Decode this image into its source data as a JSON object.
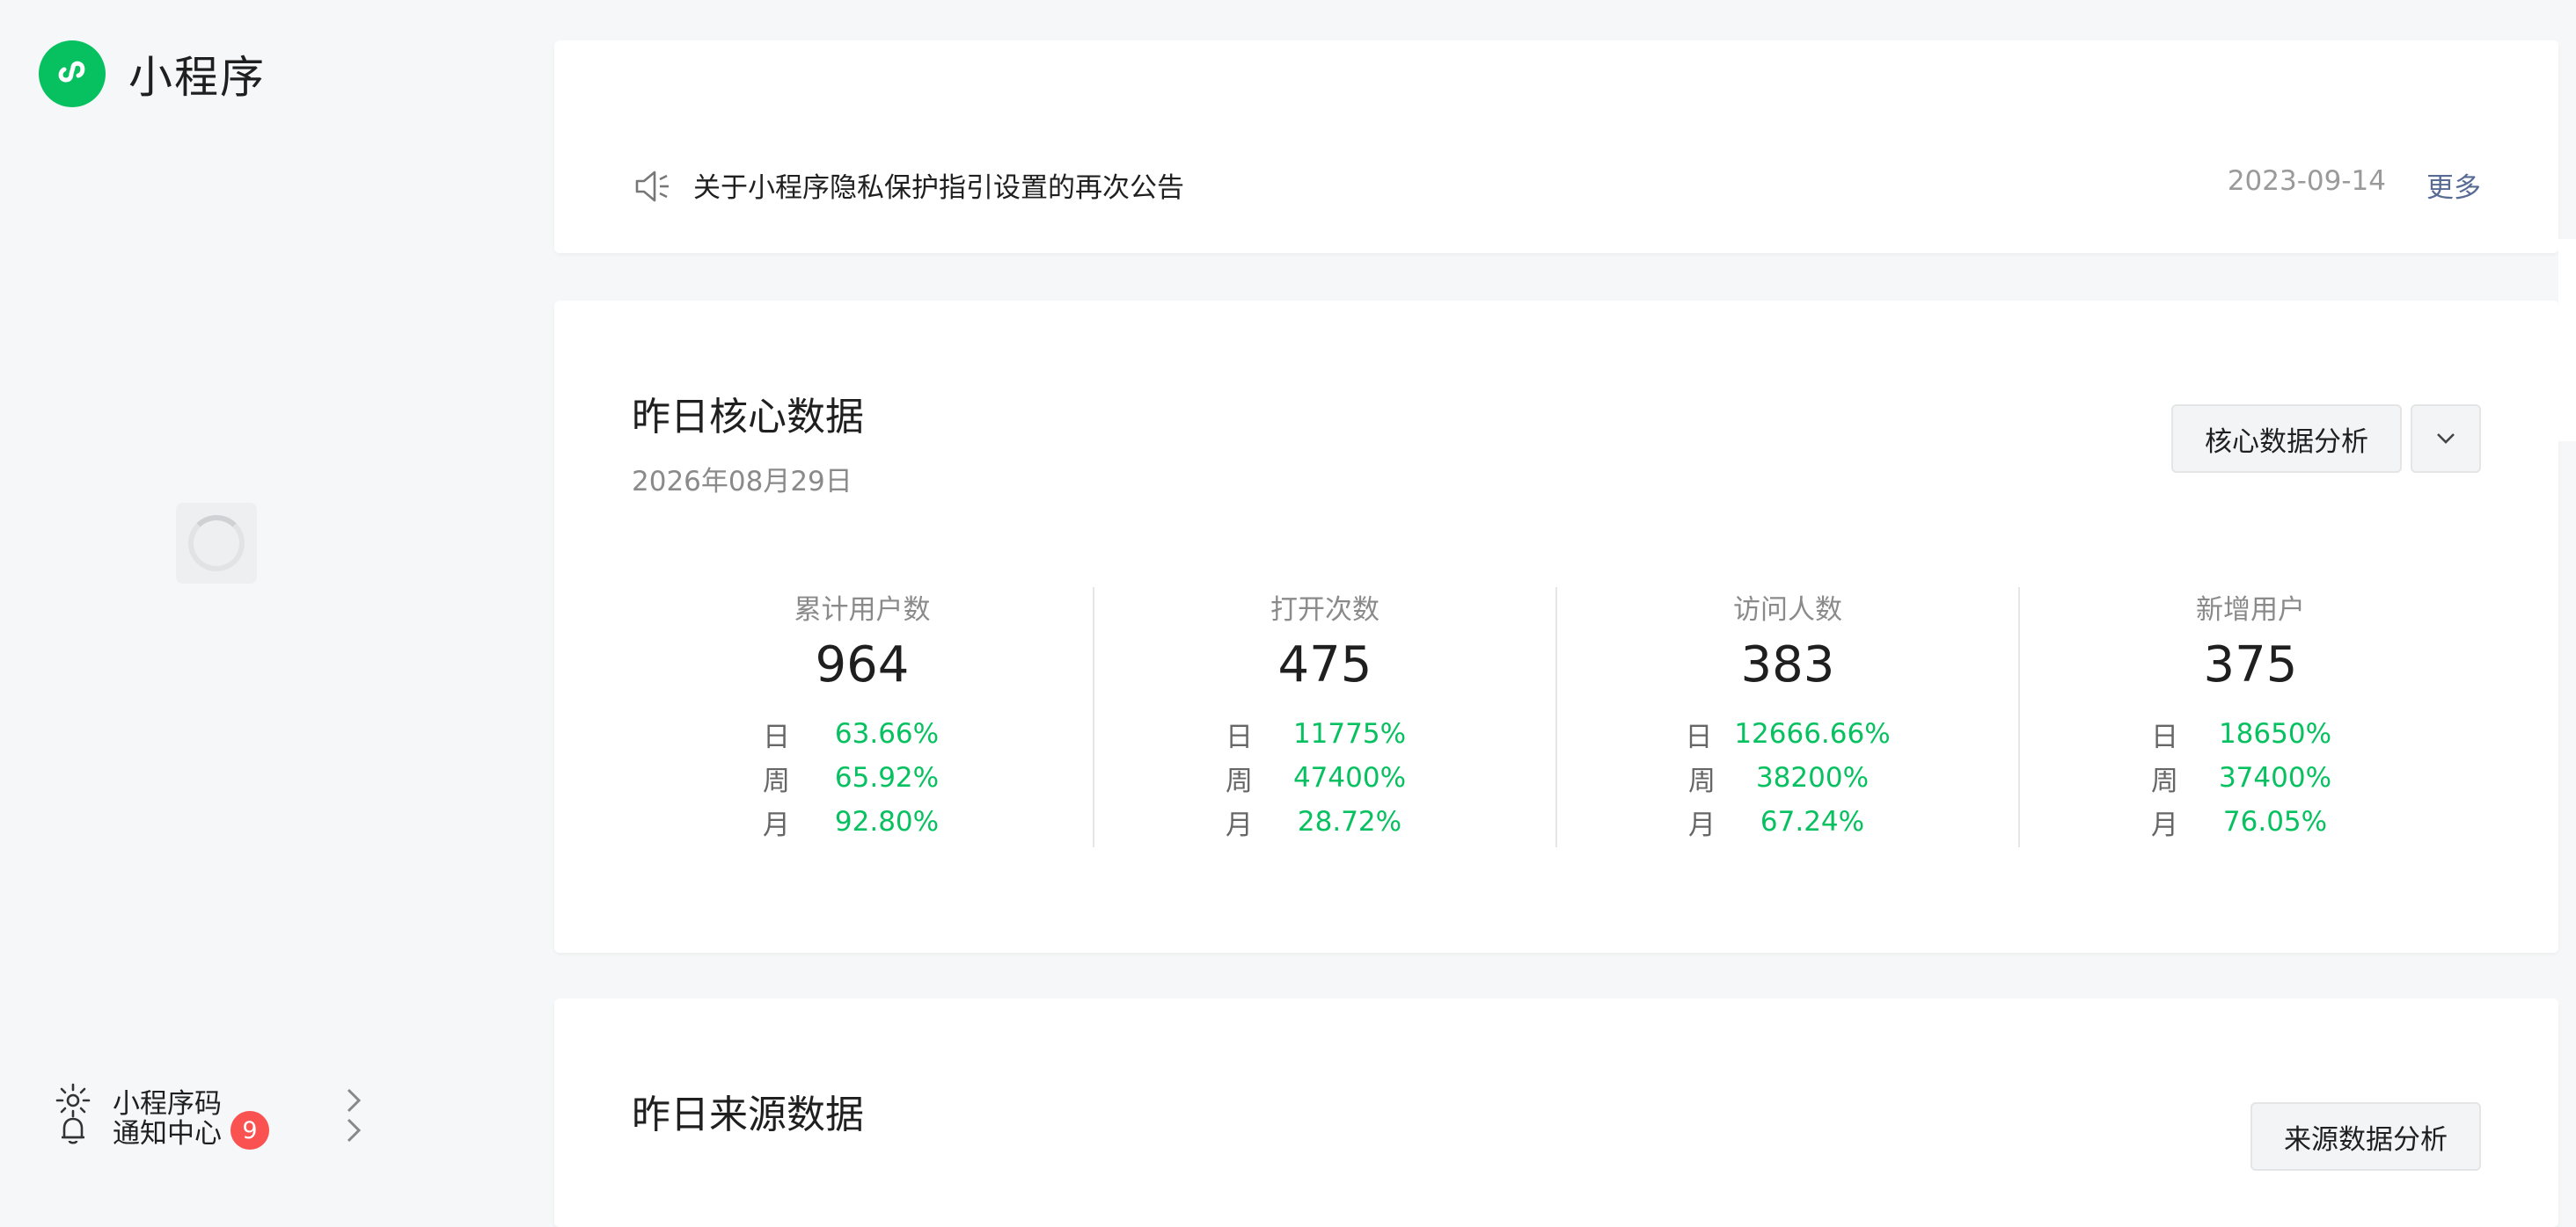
{
  "app": {
    "title": "小程序"
  },
  "sidebar": {
    "items": [
      {
        "label": "小程序码",
        "icon": "qrcode-sparkle-icon"
      },
      {
        "label": "通知中心",
        "icon": "bell-icon",
        "badge": "9"
      }
    ]
  },
  "notice": {
    "title": "关于小程序隐私保护指引设置的再次公告",
    "date": "2023-09-14",
    "more": "更多"
  },
  "core": {
    "title": "昨日核心数据",
    "date": "2026年08月29日",
    "analysis_button": "核心数据分析",
    "metrics": [
      {
        "label": "累计用户数",
        "value": "964",
        "day_label": "日",
        "day": "63.66%",
        "week_label": "周",
        "week": "65.92%",
        "month_label": "月",
        "month": "92.80%"
      },
      {
        "label": "打开次数",
        "value": "475",
        "day_label": "日",
        "day": "11775%",
        "week_label": "周",
        "week": "47400%",
        "month_label": "月",
        "month": "28.72%"
      },
      {
        "label": "访问人数",
        "value": "383",
        "day_label": "日",
        "day": "12666.66%",
        "week_label": "周",
        "week": "38200%",
        "month_label": "月",
        "month": "67.24%"
      },
      {
        "label": "新增用户",
        "value": "375",
        "day_label": "日",
        "day": "18650%",
        "week_label": "周",
        "week": "37400%",
        "month_label": "月",
        "month": "76.05%"
      }
    ]
  },
  "source": {
    "title": "昨日来源数据",
    "analysis_button": "来源数据分析"
  },
  "colors": {
    "brand": "#07c160",
    "positive": "#07c160",
    "link": "#576b95",
    "badge": "#fa5151"
  }
}
